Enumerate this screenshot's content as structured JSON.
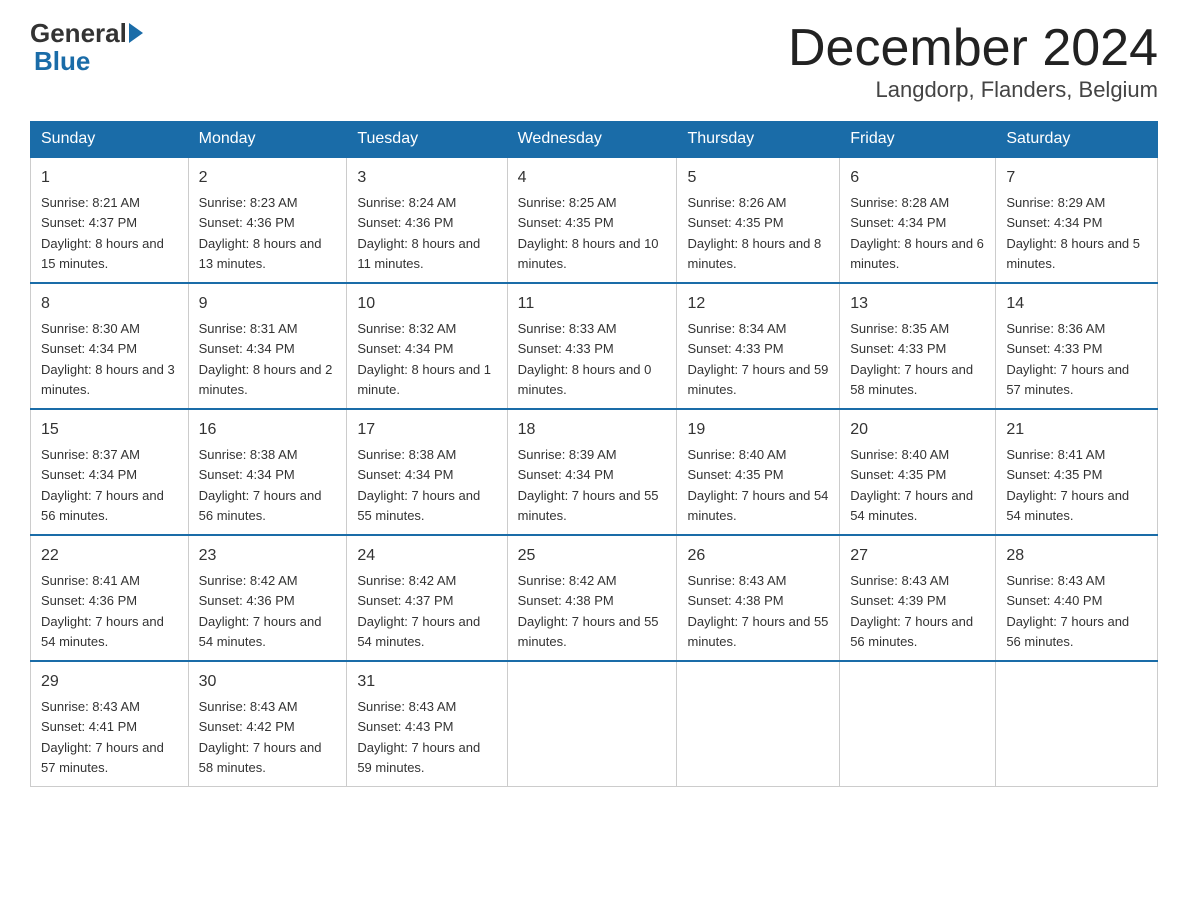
{
  "header": {
    "logo_general": "General",
    "logo_blue": "Blue",
    "month": "December 2024",
    "location": "Langdorp, Flanders, Belgium"
  },
  "days_of_week": [
    "Sunday",
    "Monday",
    "Tuesday",
    "Wednesday",
    "Thursday",
    "Friday",
    "Saturday"
  ],
  "weeks": [
    [
      {
        "day": "1",
        "sunrise": "8:21 AM",
        "sunset": "4:37 PM",
        "daylight": "8 hours and 15 minutes."
      },
      {
        "day": "2",
        "sunrise": "8:23 AM",
        "sunset": "4:36 PM",
        "daylight": "8 hours and 13 minutes."
      },
      {
        "day": "3",
        "sunrise": "8:24 AM",
        "sunset": "4:36 PM",
        "daylight": "8 hours and 11 minutes."
      },
      {
        "day": "4",
        "sunrise": "8:25 AM",
        "sunset": "4:35 PM",
        "daylight": "8 hours and 10 minutes."
      },
      {
        "day": "5",
        "sunrise": "8:26 AM",
        "sunset": "4:35 PM",
        "daylight": "8 hours and 8 minutes."
      },
      {
        "day": "6",
        "sunrise": "8:28 AM",
        "sunset": "4:34 PM",
        "daylight": "8 hours and 6 minutes."
      },
      {
        "day": "7",
        "sunrise": "8:29 AM",
        "sunset": "4:34 PM",
        "daylight": "8 hours and 5 minutes."
      }
    ],
    [
      {
        "day": "8",
        "sunrise": "8:30 AM",
        "sunset": "4:34 PM",
        "daylight": "8 hours and 3 minutes."
      },
      {
        "day": "9",
        "sunrise": "8:31 AM",
        "sunset": "4:34 PM",
        "daylight": "8 hours and 2 minutes."
      },
      {
        "day": "10",
        "sunrise": "8:32 AM",
        "sunset": "4:34 PM",
        "daylight": "8 hours and 1 minute."
      },
      {
        "day": "11",
        "sunrise": "8:33 AM",
        "sunset": "4:33 PM",
        "daylight": "8 hours and 0 minutes."
      },
      {
        "day": "12",
        "sunrise": "8:34 AM",
        "sunset": "4:33 PM",
        "daylight": "7 hours and 59 minutes."
      },
      {
        "day": "13",
        "sunrise": "8:35 AM",
        "sunset": "4:33 PM",
        "daylight": "7 hours and 58 minutes."
      },
      {
        "day": "14",
        "sunrise": "8:36 AM",
        "sunset": "4:33 PM",
        "daylight": "7 hours and 57 minutes."
      }
    ],
    [
      {
        "day": "15",
        "sunrise": "8:37 AM",
        "sunset": "4:34 PM",
        "daylight": "7 hours and 56 minutes."
      },
      {
        "day": "16",
        "sunrise": "8:38 AM",
        "sunset": "4:34 PM",
        "daylight": "7 hours and 56 minutes."
      },
      {
        "day": "17",
        "sunrise": "8:38 AM",
        "sunset": "4:34 PM",
        "daylight": "7 hours and 55 minutes."
      },
      {
        "day": "18",
        "sunrise": "8:39 AM",
        "sunset": "4:34 PM",
        "daylight": "7 hours and 55 minutes."
      },
      {
        "day": "19",
        "sunrise": "8:40 AM",
        "sunset": "4:35 PM",
        "daylight": "7 hours and 54 minutes."
      },
      {
        "day": "20",
        "sunrise": "8:40 AM",
        "sunset": "4:35 PM",
        "daylight": "7 hours and 54 minutes."
      },
      {
        "day": "21",
        "sunrise": "8:41 AM",
        "sunset": "4:35 PM",
        "daylight": "7 hours and 54 minutes."
      }
    ],
    [
      {
        "day": "22",
        "sunrise": "8:41 AM",
        "sunset": "4:36 PM",
        "daylight": "7 hours and 54 minutes."
      },
      {
        "day": "23",
        "sunrise": "8:42 AM",
        "sunset": "4:36 PM",
        "daylight": "7 hours and 54 minutes."
      },
      {
        "day": "24",
        "sunrise": "8:42 AM",
        "sunset": "4:37 PM",
        "daylight": "7 hours and 54 minutes."
      },
      {
        "day": "25",
        "sunrise": "8:42 AM",
        "sunset": "4:38 PM",
        "daylight": "7 hours and 55 minutes."
      },
      {
        "day": "26",
        "sunrise": "8:43 AM",
        "sunset": "4:38 PM",
        "daylight": "7 hours and 55 minutes."
      },
      {
        "day": "27",
        "sunrise": "8:43 AM",
        "sunset": "4:39 PM",
        "daylight": "7 hours and 56 minutes."
      },
      {
        "day": "28",
        "sunrise": "8:43 AM",
        "sunset": "4:40 PM",
        "daylight": "7 hours and 56 minutes."
      }
    ],
    [
      {
        "day": "29",
        "sunrise": "8:43 AM",
        "sunset": "4:41 PM",
        "daylight": "7 hours and 57 minutes."
      },
      {
        "day": "30",
        "sunrise": "8:43 AM",
        "sunset": "4:42 PM",
        "daylight": "7 hours and 58 minutes."
      },
      {
        "day": "31",
        "sunrise": "8:43 AM",
        "sunset": "4:43 PM",
        "daylight": "7 hours and 59 minutes."
      },
      null,
      null,
      null,
      null
    ]
  ],
  "labels": {
    "sunrise": "Sunrise:",
    "sunset": "Sunset:",
    "daylight": "Daylight:"
  }
}
